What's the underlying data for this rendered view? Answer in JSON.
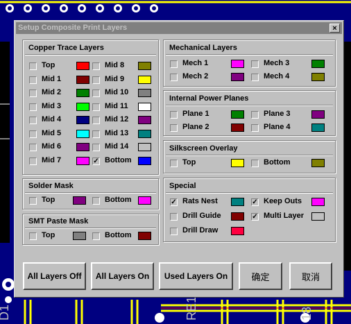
{
  "dialog_title": "Setup Composite Print Layers",
  "close_glyph": "×",
  "check_glyph": "✓",
  "background_labels": [
    "D1",
    "RE1",
    "18"
  ],
  "copper": {
    "title": "Copper Trace Layers",
    "left": [
      {
        "label": "Top",
        "color": "#ff0000",
        "checked": false
      },
      {
        "label": "Mid 1",
        "color": "#800000",
        "checked": false
      },
      {
        "label": "Mid 2",
        "color": "#008000",
        "checked": false
      },
      {
        "label": "Mid 3",
        "color": "#00ff00",
        "checked": false
      },
      {
        "label": "Mid 4",
        "color": "#000080",
        "checked": false
      },
      {
        "label": "Mid 5",
        "color": "#00ffff",
        "checked": false
      },
      {
        "label": "Mid 6",
        "color": "#800080",
        "checked": false
      },
      {
        "label": "Mid 7",
        "color": "#ff00ff",
        "checked": false
      }
    ],
    "right": [
      {
        "label": "Mid 8",
        "color": "#808000",
        "checked": false
      },
      {
        "label": "Mid 9",
        "color": "#ffff00",
        "checked": false
      },
      {
        "label": "Mid 10",
        "color": "#808080",
        "checked": false
      },
      {
        "label": "Mid 11",
        "color": "#ffffff",
        "checked": false
      },
      {
        "label": "Mid 12",
        "color": "#800080",
        "checked": false
      },
      {
        "label": "Mid 13",
        "color": "#008080",
        "checked": false
      },
      {
        "label": "Mid 14",
        "color": "#c0c0c0",
        "checked": false
      },
      {
        "label": "Bottom",
        "color": "#0000ff",
        "checked": true
      }
    ]
  },
  "mechanical": {
    "title": "Mechanical Layers",
    "items": [
      {
        "label": "Mech 1",
        "color": "#ff00ff",
        "checked": false
      },
      {
        "label": "Mech 3",
        "color": "#008000",
        "checked": false
      },
      {
        "label": "Mech 2",
        "color": "#800080",
        "checked": false
      },
      {
        "label": "Mech 4",
        "color": "#808000",
        "checked": false
      }
    ]
  },
  "power": {
    "title": "Internal Power Planes",
    "items": [
      {
        "label": "Plane 1",
        "color": "#008000",
        "checked": false
      },
      {
        "label": "Plane 3",
        "color": "#800080",
        "checked": false
      },
      {
        "label": "Plane 2",
        "color": "#800000",
        "checked": false
      },
      {
        "label": "Plane 4",
        "color": "#008080",
        "checked": false
      }
    ]
  },
  "silkscreen": {
    "title": "Silkscreen Overlay",
    "items": [
      {
        "label": "Top",
        "color": "#ffff00",
        "checked": false
      },
      {
        "label": "Bottom",
        "color": "#808000",
        "checked": false
      }
    ]
  },
  "solder": {
    "title": "Solder Mask",
    "items": [
      {
        "label": "Top",
        "color": "#800080",
        "checked": false
      },
      {
        "label": "Bottom",
        "color": "#ff00ff",
        "checked": false
      }
    ]
  },
  "paste": {
    "title": "SMT Paste Mask",
    "items": [
      {
        "label": "Top",
        "color": "#808080",
        "checked": false
      },
      {
        "label": "Bottom",
        "color": "#800000",
        "checked": false
      }
    ]
  },
  "special": {
    "title": "Special",
    "items": [
      {
        "label": "Rats Nest",
        "color": "#008080",
        "checked": true
      },
      {
        "label": "Keep Outs",
        "color": "#ff00ff",
        "checked": true
      },
      {
        "label": "Drill Guide",
        "color": "#800000",
        "checked": false
      },
      {
        "label": "Multi Layer",
        "color": "#c0c0c0",
        "checked": true
      },
      {
        "label": "Drill Draw",
        "color": "#ff0040",
        "checked": false
      }
    ]
  },
  "buttons": {
    "all_off": "All Layers Off",
    "all_on": "All Layers On",
    "used_on": "Used Layers On",
    "ok": "确定",
    "cancel": "取消"
  }
}
